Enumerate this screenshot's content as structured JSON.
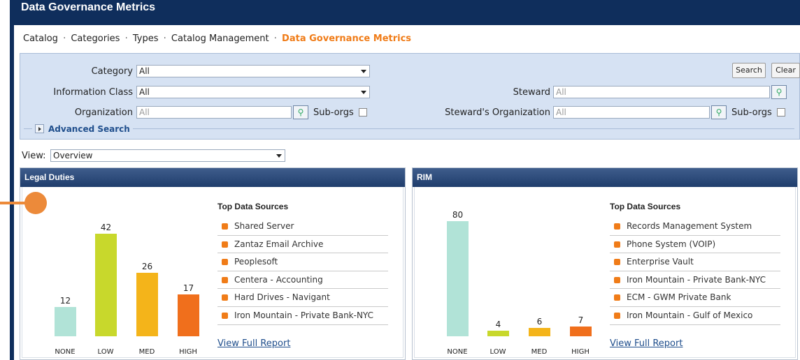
{
  "window": {
    "title": "Data Governance Metrics"
  },
  "breadcrumb": {
    "items": [
      "Catalog",
      "Categories",
      "Types",
      "Catalog Management"
    ],
    "current": "Data Governance Metrics"
  },
  "filters": {
    "category": {
      "label": "Category",
      "value": "All"
    },
    "information_class": {
      "label": "Information Class",
      "value": "All"
    },
    "organization": {
      "label": "Organization",
      "placeholder": "All",
      "suborgs_label": "Sub-orgs"
    },
    "steward": {
      "label": "Steward",
      "placeholder": "All"
    },
    "stewards_org": {
      "label": "Steward's Organization",
      "placeholder": "All",
      "suborgs_label": "Sub-orgs"
    },
    "search_label": "Search",
    "clear_label": "Clear",
    "advanced_label": "Advanced Search"
  },
  "view": {
    "label": "View:",
    "value": "Overview"
  },
  "panels": [
    {
      "title": "Legal Duties",
      "chart_data": {
        "type": "bar",
        "categories": [
          "NONE",
          "LOW",
          "MED",
          "HIGH"
        ],
        "values": [
          12,
          42,
          26,
          17
        ],
        "colors": [
          "#b1e3d7",
          "#c8d82c",
          "#f4b41a",
          "#f06f1c"
        ],
        "ylim": [
          0,
          50
        ]
      },
      "sources_title": "Top Data Sources",
      "sources": [
        "Shared Server",
        "Zantaz Email Archive",
        "Peoplesoft",
        "Centera - Accounting",
        "Hard Drives - Navigant",
        "Iron Mountain - Private Bank-NYC"
      ],
      "report_link": "View Full Report"
    },
    {
      "title": "RIM",
      "chart_data": {
        "type": "bar",
        "categories": [
          "NONE",
          "LOW",
          "MED",
          "HIGH"
        ],
        "values": [
          80,
          4,
          6,
          7
        ],
        "colors": [
          "#b1e3d7",
          "#c8d82c",
          "#f4b41a",
          "#f06f1c"
        ],
        "ylim": [
          0,
          85
        ]
      },
      "sources_title": "Top Data Sources",
      "sources": [
        "Records Management System",
        "Phone System (VOIP)",
        "Enterprise Vault",
        "Iron Mountain - Private Bank-NYC",
        "ECM - GWM Private Bank",
        "Iron Mountain - Gulf of Mexico"
      ],
      "report_link": "View Full Report"
    }
  ],
  "colors": {
    "accent": "#f07c18",
    "header": "#0f2e5c",
    "link": "#1f4e8c"
  }
}
